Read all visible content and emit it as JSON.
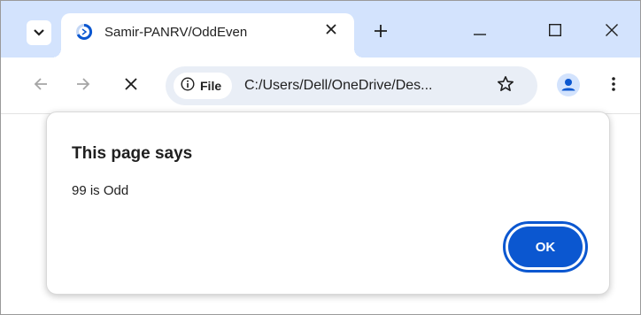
{
  "tab": {
    "title": "Samir-PANRV/OddEven",
    "favicon": "loading-spinner-icon"
  },
  "toolbar": {
    "site_chip_label": "File",
    "url": "C:/Users/Dell/OneDrive/Des..."
  },
  "dialog": {
    "title": "This page says",
    "message": "99 is Odd",
    "ok_label": "OK"
  },
  "colors": {
    "tabstrip_bg": "#d3e3fd",
    "omnibox_bg": "#e9eef6",
    "accent": "#0b57d0",
    "profile_icon": "#0b57d0"
  }
}
